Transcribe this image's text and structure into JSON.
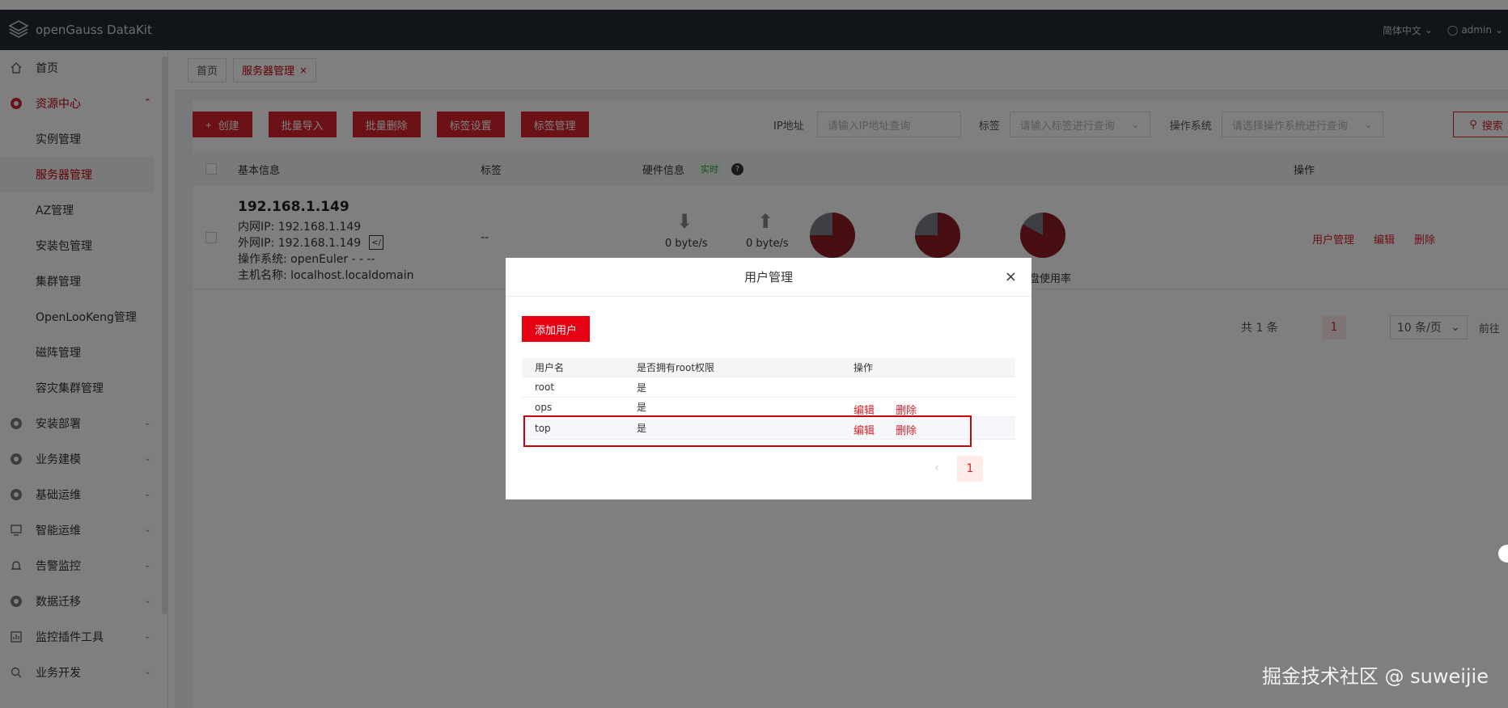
{
  "app": {
    "title": "openGauss DataKit"
  },
  "header": {
    "language": "简体中文",
    "user": "admin"
  },
  "sidebar": {
    "items": [
      {
        "label": "首页",
        "icon": "home-icon"
      },
      {
        "label": "资源中心",
        "icon": "gear-icon",
        "expanded": true
      },
      {
        "label": "实例管理"
      },
      {
        "label": "服务器管理",
        "active": true
      },
      {
        "label": "AZ管理"
      },
      {
        "label": "安装包管理"
      },
      {
        "label": "集群管理"
      },
      {
        "label": "OpenLooKeng管理"
      },
      {
        "label": "磁阵管理"
      },
      {
        "label": "容灾集群管理"
      },
      {
        "label": "安装部署",
        "icon": "gear-icon"
      },
      {
        "label": "业务建模",
        "icon": "gear-icon"
      },
      {
        "label": "基础运维",
        "icon": "gear-icon"
      },
      {
        "label": "智能运维",
        "icon": "monitor-icon"
      },
      {
        "label": "告警监控",
        "icon": "alarm-icon"
      },
      {
        "label": "数据迁移",
        "icon": "gear-icon"
      },
      {
        "label": "监控插件工具",
        "icon": "chart-icon"
      },
      {
        "label": "业务开发",
        "icon": "search-icon"
      }
    ]
  },
  "tabs": [
    {
      "label": "首页"
    },
    {
      "label": "服务器管理",
      "close": "×"
    }
  ],
  "toolbar": {
    "create": "创建",
    "create_icon": "+",
    "batch_import": "批量导入",
    "batch_delete": "批量删除",
    "tag_settings": "标签设置",
    "tag_manage": "标签管理"
  },
  "filters": {
    "ip_label": "IP地址",
    "ip_placeholder": "请输入IP地址查询",
    "tag_label": "标签",
    "tag_placeholder": "请输入标签进行查询",
    "os_label": "操作系统",
    "os_placeholder": "请选择操作系统进行查询",
    "search": "搜索"
  },
  "table": {
    "headers": {
      "basic": "基本信息",
      "tags": "标签",
      "hardware": "硬件信息",
      "realtime": "实时",
      "help": "?",
      "ops": "操作"
    },
    "row": {
      "ip": "192.168.1.149",
      "lan": "内网IP:  192.168.1.149",
      "wan": "外网IP:  192.168.1.149",
      "os": "操作系统:  openEuler - - --",
      "host": "主机名称:  localhost.localdomain",
      "tags": "--",
      "down_rate": "0 byte/s",
      "up_rate": "0 byte/s",
      "disk_usage_label": "盘使用率",
      "pie_usage": [
        0.75,
        0.75,
        0.83
      ],
      "actions": {
        "user_mgmt": "用户管理",
        "edit": "编辑",
        "delete": "删除"
      }
    }
  },
  "pagination": {
    "total": "共 1 条",
    "page": "1",
    "page_size": "10 条/页",
    "goto": "前往"
  },
  "dialog": {
    "title": "用户管理",
    "close": "×",
    "add_user": "添加用户",
    "headers": {
      "username": "用户名",
      "root": "是否拥有root权限",
      "ops": "操作"
    },
    "rows": [
      {
        "username": "root",
        "root": "是",
        "edit": "",
        "delete": ""
      },
      {
        "username": "ops",
        "root": "是",
        "edit": "编辑",
        "delete": "删除"
      },
      {
        "username": "top",
        "root": "是",
        "edit": "编辑",
        "delete": "删除"
      }
    ],
    "page": "1",
    "prev": "‹"
  },
  "watermark": "掘金技术社区 @ suweijie",
  "colors": {
    "brand_red": "#d8232a",
    "header_bg": "#232833"
  }
}
